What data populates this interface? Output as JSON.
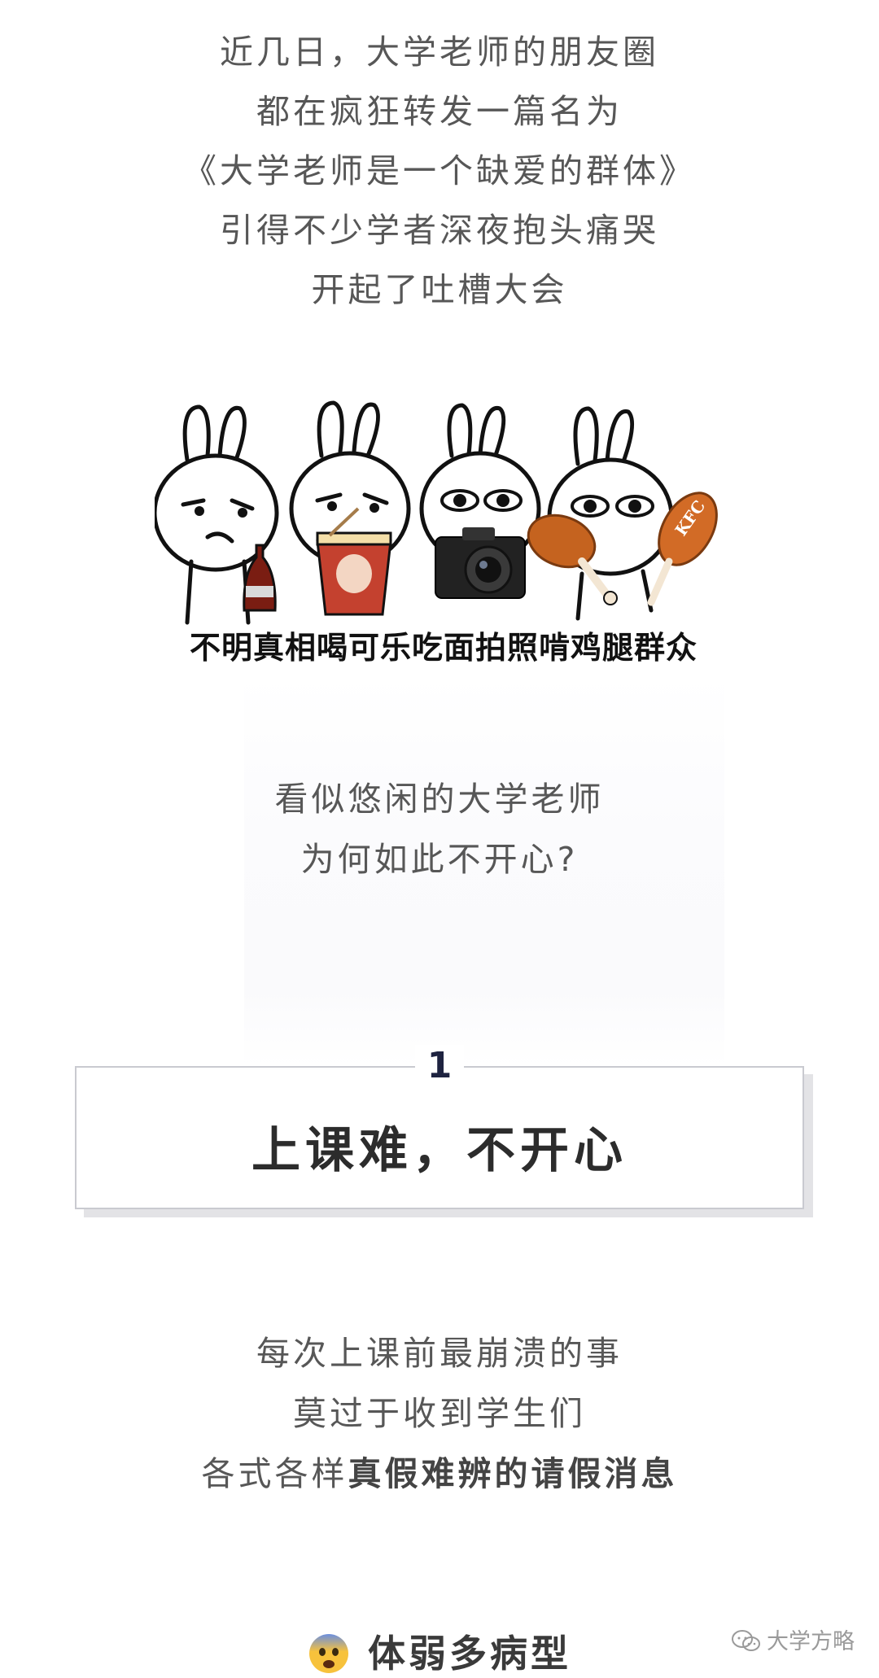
{
  "intro_lines": [
    "近几日，大学老师的朋友圈",
    "都在疯狂转发一篇名为",
    "《大学老师是一个缺爱的群体》",
    "引得不少学者深夜抱头痛哭",
    "开起了吐槽大会"
  ],
  "meme": {
    "caption": "不明真相喝可乐吃面拍照啃鸡腿群众",
    "kfc_label": "KFC"
  },
  "question_lines": [
    "看似悠闲的大学老师",
    "为何如此不开心?"
  ],
  "section": {
    "number": "1",
    "title": "上课难，不开心"
  },
  "body_lines": {
    "line1": "每次上课前最崩溃的事",
    "line2": "莫过于收到学生们",
    "line3_prefix": "各式各样",
    "line3_emphasis": "真假难辨的请假消息"
  },
  "sub_heading": {
    "emoji": "fearful-face-icon",
    "text": "体弱多病型"
  },
  "watermark": {
    "icon": "wechat-icon",
    "text": "大学方略"
  }
}
